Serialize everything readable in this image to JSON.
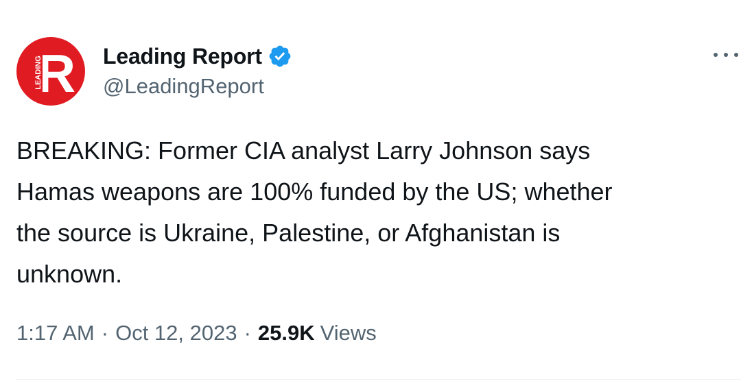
{
  "author": {
    "display_name": "Leading Report",
    "handle": "@LeadingReport",
    "verified": true,
    "avatar_icon": "leading-report-logo",
    "avatar_letter": "R",
    "avatar_text": "LEADING",
    "avatar_color": "#e11b22"
  },
  "tweet": {
    "text": "BREAKING: Former CIA analyst Larry Johnson says\nHamas weapons are 100% funded by the US; whether\nthe source is Ukraine, Palestine, or Afghanistan is\nunknown."
  },
  "meta": {
    "time": "1:17 AM",
    "separator": "·",
    "date": "Oct 12, 2023",
    "views_count": "25.9K",
    "views_label": "Views"
  },
  "colors": {
    "text": "#0f1419",
    "secondary": "#536471",
    "verified": "#1d9bf0",
    "divider": "#eff3f4"
  }
}
